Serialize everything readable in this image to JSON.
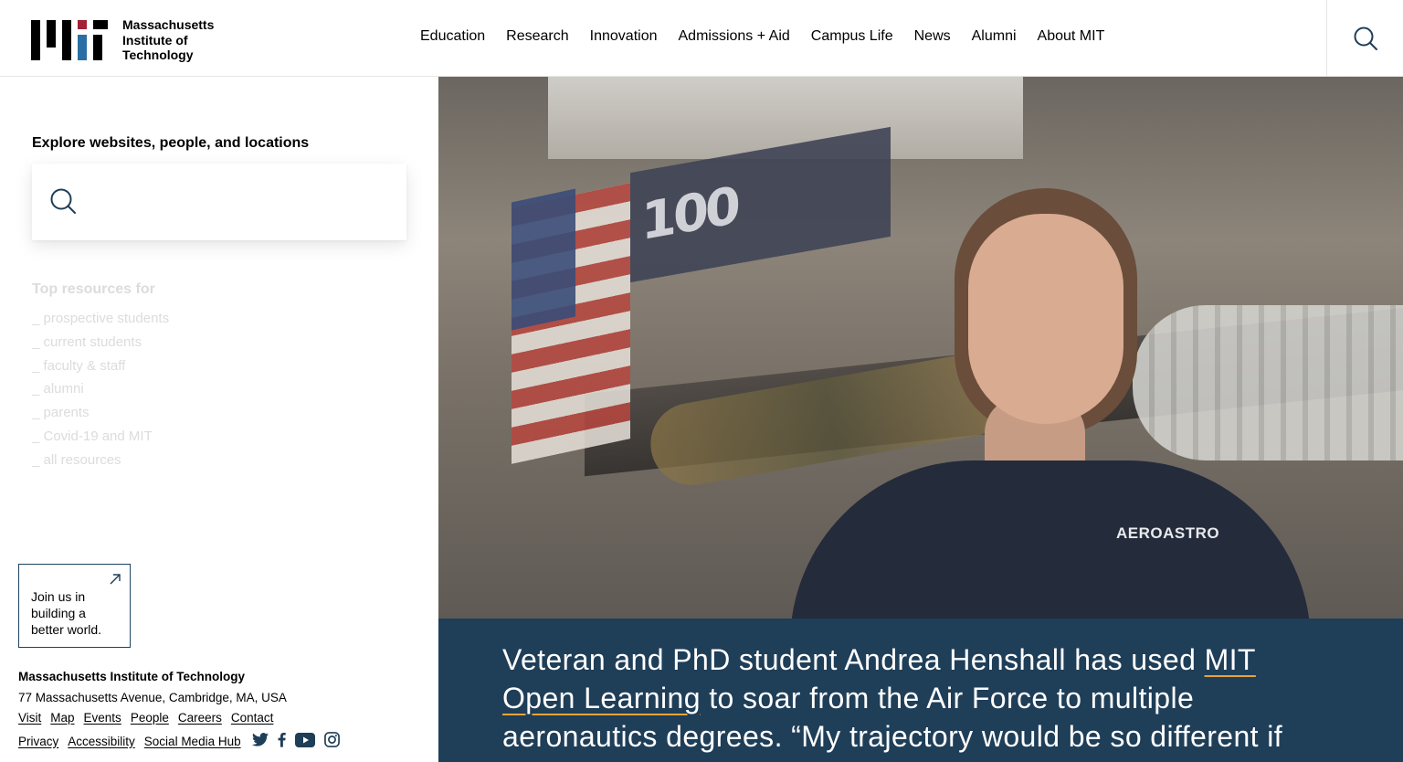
{
  "header": {
    "logo_name": "MIT logo",
    "wordmark": [
      "Massachusetts",
      "Institute of",
      "Technology"
    ],
    "nav": [
      "Education",
      "Research",
      "Innovation",
      "Admissions + Aid",
      "Campus Life",
      "News",
      "Alumni",
      "About MIT"
    ],
    "search_icon": "search-icon"
  },
  "explore": {
    "title": "Explore websites, people, and locations",
    "search_icon": "search-icon",
    "search_value": ""
  },
  "resources": {
    "title": "Top resources for",
    "items": [
      "_ prospective students",
      "_ current students",
      "_ faculty & staff",
      "_ alumni",
      "_ parents",
      "_ Covid-19 and MIT",
      "_ all resources"
    ]
  },
  "join": {
    "text": "Join us in building a better world.",
    "icon": "arrow-up-right-icon"
  },
  "footer": {
    "name": "Massachusetts Institute of Technology",
    "address": "77 Massachusetts Avenue, Cambridge, MA, USA",
    "links_row1": [
      "Visit",
      "Map",
      "Events",
      "People",
      "Careers",
      "Contact"
    ],
    "links_row2": [
      "Privacy",
      "Accessibility",
      "Social Media Hub"
    ],
    "social_icons": [
      "twitter-icon",
      "facebook-icon",
      "youtube-icon",
      "instagram-icon"
    ]
  },
  "hero": {
    "chest_logo": "AEROASTRO",
    "banner_text": "100"
  },
  "caption": {
    "before_link": "Veteran and PhD student Andrea Henshall has used ",
    "link": "MIT Open Learning",
    "after_link": " to soar from the Air Force to multiple aeronautics degrees. “My trajectory would be so different if"
  },
  "colors": {
    "caption_bg": "#1f3e58",
    "link_underline": "#e8a33b",
    "icon_blue": "#1f3e58"
  }
}
